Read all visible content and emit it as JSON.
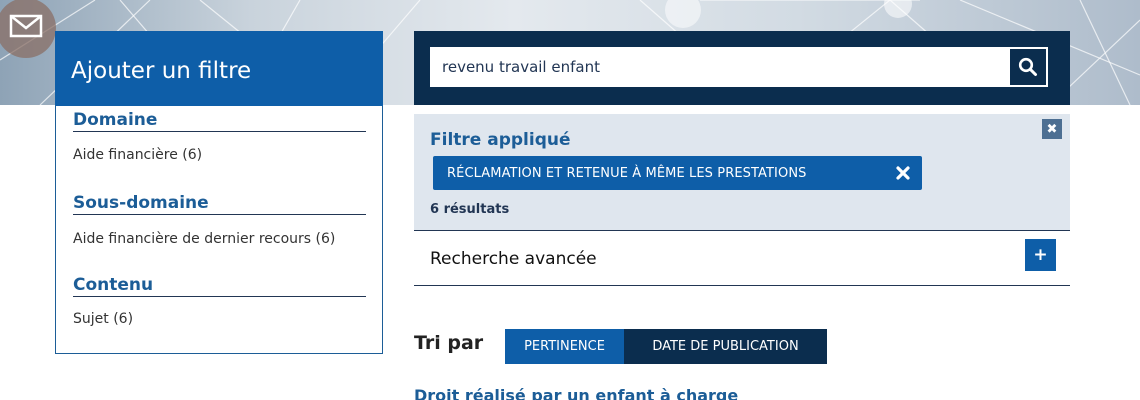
{
  "filter_panel": {
    "title": "Ajouter un filtre",
    "facets": [
      {
        "title": "Domaine",
        "items": [
          "Aide financière (6)"
        ]
      },
      {
        "title": "Sous-domaine",
        "items": [
          "Aide financière de dernier recours (6)"
        ]
      },
      {
        "title": "Contenu",
        "items": [
          "Sujet (6)"
        ]
      }
    ]
  },
  "search": {
    "value": "revenu travail enfant",
    "button_icon": "search-icon"
  },
  "applied_filter": {
    "title": "Filtre appliqué",
    "chip_label": "RÉCLAMATION ET RETENUE À MÊME LES PRESTATIONS",
    "chip_remove_icon": "close-icon",
    "close_icon_glyph": "✖",
    "results_count": "6 résultats"
  },
  "advanced_search": {
    "label": "Recherche avancée",
    "expand_glyph": "+"
  },
  "sort": {
    "label": "Tri par",
    "options": [
      "PERTINENCE",
      "DATE DE PUBLICATION"
    ],
    "active": "PERTINENCE"
  },
  "results": [
    {
      "title": "Droit réalisé par un enfant à charge"
    }
  ],
  "colors": {
    "primary_blue": "#0e5ea8",
    "dark_navy": "#0b2d4e",
    "applied_bg": "#dfe6ee",
    "link_blue": "#1c5d97"
  }
}
